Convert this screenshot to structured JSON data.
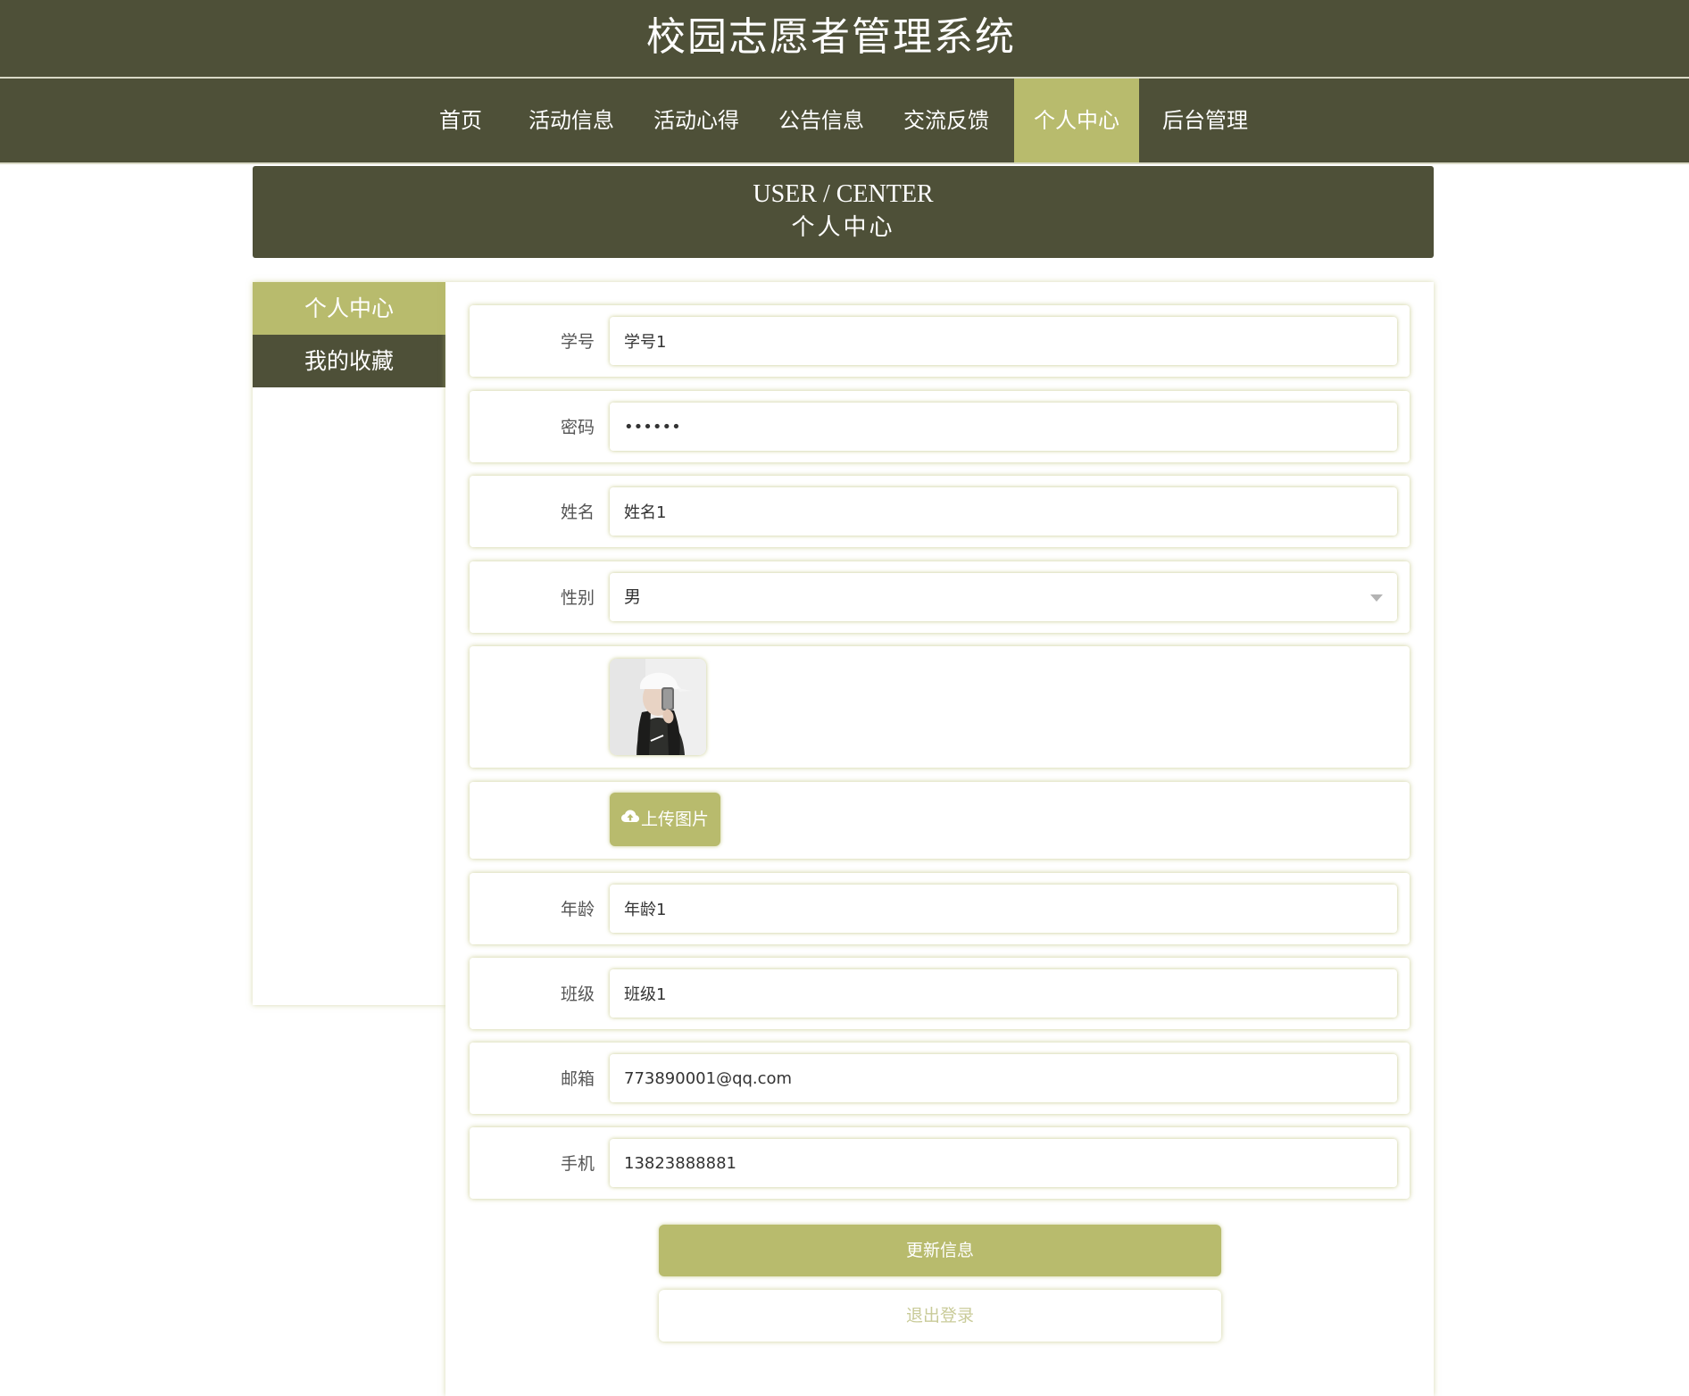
{
  "header": {
    "title": "校园志愿者管理系统"
  },
  "nav": {
    "items": [
      {
        "label": "首页"
      },
      {
        "label": "活动信息"
      },
      {
        "label": "活动心得"
      },
      {
        "label": "公告信息"
      },
      {
        "label": "交流反馈"
      },
      {
        "label": "个人中心",
        "active": true
      },
      {
        "label": "后台管理"
      }
    ]
  },
  "banner": {
    "en": "USER / CENTER",
    "cn": "个人中心"
  },
  "sidebar": {
    "items": [
      {
        "label": "个人中心",
        "active": true
      },
      {
        "label": "我的收藏"
      }
    ]
  },
  "form": {
    "student_id": {
      "label": "学号",
      "value": "学号1"
    },
    "password": {
      "label": "密码",
      "value": "123456"
    },
    "name": {
      "label": "姓名",
      "value": "姓名1"
    },
    "gender": {
      "label": "性别",
      "value": "男"
    },
    "avatar": {
      "alt": "头像"
    },
    "upload": {
      "label": "上传图片",
      "icon": "cloud-upload-icon"
    },
    "age": {
      "label": "年龄",
      "value": "年龄1"
    },
    "class": {
      "label": "班级",
      "value": "班级1"
    },
    "email": {
      "label": "邮箱",
      "value": "773890001@qq.com"
    },
    "phone": {
      "label": "手机",
      "value": "13823888881"
    }
  },
  "actions": {
    "update_label": "更新信息",
    "logout_label": "退出登录"
  },
  "colors": {
    "primary_dark": "#4e5038",
    "accent": "#b8bb6d",
    "logout_text": "#c9cb99"
  }
}
